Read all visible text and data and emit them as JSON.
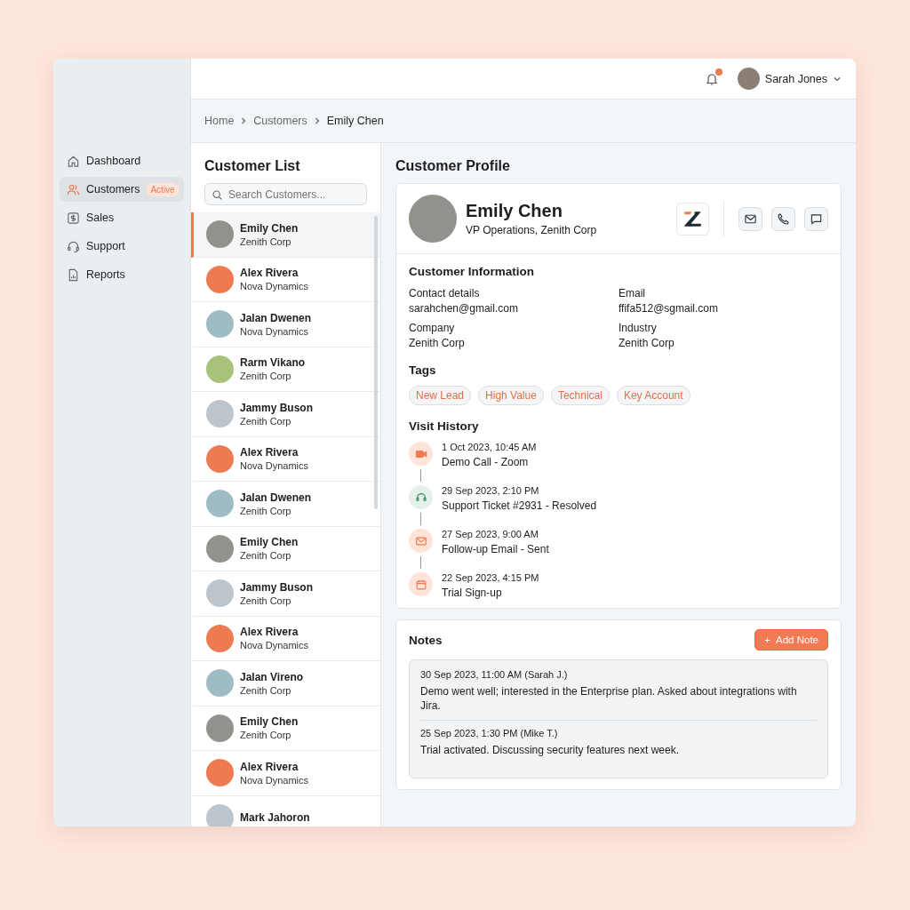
{
  "header": {
    "notification_dot": true,
    "user": {
      "name": "Sarah Jones"
    }
  },
  "sidebar": {
    "items": [
      {
        "label": "Dashboard",
        "kind": "home",
        "selected": false
      },
      {
        "label": "Customers",
        "kind": "people",
        "selected": true,
        "badge": "Active"
      },
      {
        "label": "Sales",
        "kind": "dollar",
        "selected": false
      },
      {
        "label": "Support",
        "kind": "headset",
        "selected": false
      },
      {
        "label": "Reports",
        "kind": "report",
        "selected": false
      }
    ]
  },
  "breadcrumb": [
    "Home",
    "Customers",
    "Emily Chen"
  ],
  "customer_list": {
    "title": "Customer List",
    "search": {
      "placeholder": "Search Customers..."
    },
    "customers": [
      {
        "name": "Emily Chen",
        "company": "Zenith Corp",
        "color": "#8f938c",
        "selected": true
      },
      {
        "name": "Alex Rivera",
        "company": "Nova Dynamics",
        "color": "#ee7a52",
        "selected": false
      },
      {
        "name": "Jalan Dwenen",
        "company": "Nova Dynamics",
        "color": "#9fbcc4",
        "selected": false
      },
      {
        "name": "Rarm Vikano",
        "company": "Zenith Corp",
        "color": "#a9c27a",
        "selected": false
      },
      {
        "name": "Jammy Buson",
        "company": "Zenith Corp",
        "color": "#bcc5cc",
        "selected": false
      },
      {
        "name": "Alex Rivera",
        "company": "Nova Dynamics",
        "color": "#ee7a52",
        "selected": false
      },
      {
        "name": "Jalan Dwenen",
        "company": "Zenith Corp",
        "color": "#9fbcc4",
        "selected": false
      },
      {
        "name": "Emily Chen",
        "company": "Zenith Corp",
        "color": "#8f938c",
        "selected": false
      },
      {
        "name": "Jammy Buson",
        "company": "Zenith Corp",
        "color": "#bcc5cc",
        "selected": false
      },
      {
        "name": "Alex Rivera",
        "company": "Nova Dynamics",
        "color": "#ee7a52",
        "selected": false
      },
      {
        "name": "Jalan Vireno",
        "company": "Zenith Corp",
        "color": "#9fbcc4",
        "selected": false
      },
      {
        "name": "Emily Chen",
        "company": "Zenith Corp",
        "color": "#8f938c",
        "selected": false
      },
      {
        "name": "Alex Rivera",
        "company": "Nova Dynamics",
        "color": "#ee7a52",
        "selected": false
      },
      {
        "name": "Mark Jahoron",
        "color": "#bcc5cc",
        "selected": false
      }
    ]
  },
  "profile": {
    "title": "Customer Profile",
    "name": "Emily Chen",
    "role": "VP Operations, Zenith Corp",
    "info_title": "Customer Information",
    "fields": [
      {
        "label": "Contact details",
        "value": "sarahchen@gmail.com"
      },
      {
        "label": "Email",
        "value": "ffifa512@sgmail.com"
      },
      {
        "label": "Company",
        "value": "Zenith Corp"
      },
      {
        "label": "Industry",
        "value": "Zenith Corp"
      }
    ],
    "tags_title": "Tags",
    "tags": [
      "New Lead",
      "High Value",
      "Technical",
      "Key Account"
    ],
    "history_title": "Visit History",
    "visits": [
      {
        "kind": "video",
        "time": "1 Oct 2023, 10:45 AM",
        "title": "Demo Call - Zoom"
      },
      {
        "kind": "support",
        "time": "29 Sep 2023, 2:10 PM",
        "title": "Support Ticket #2931 - Resolved"
      },
      {
        "kind": "email",
        "time": "27 Sep 2023, 9:00 AM",
        "title": "Follow-up Email - Sent"
      },
      {
        "kind": "calendar",
        "time": "22 Sep 2023, 4:15 PM",
        "title": "Trial Sign-up"
      }
    ]
  },
  "notes": {
    "title": "Notes",
    "add_button": "Add Note",
    "add_icon": "+",
    "items": [
      {
        "meta": "30 Sep 2023, 11:00 AM (Sarah J.)",
        "text": "Demo went well; interested in the Enterprise plan. Asked about integrations with Jira."
      },
      {
        "meta": "25 Sep 2023, 1:30 PM (Mike T.)",
        "text": "Trial activated. Discussing security features next week."
      }
    ]
  }
}
